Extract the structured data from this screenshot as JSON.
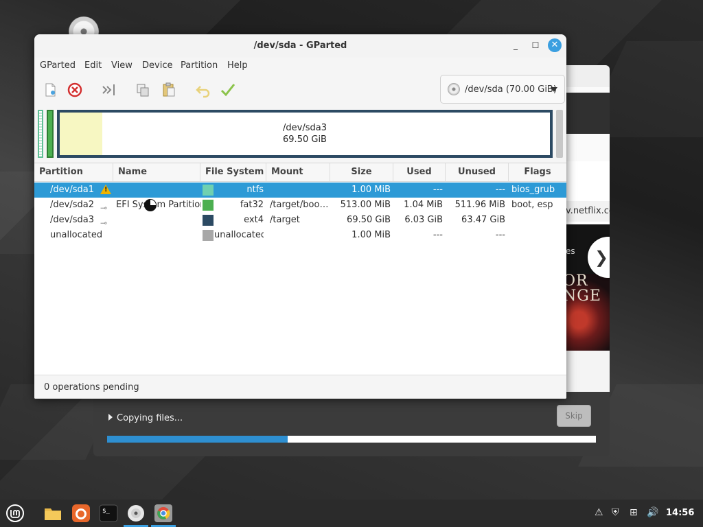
{
  "gparted": {
    "title": "/dev/sda - GParted",
    "menu": [
      "GParted",
      "Edit",
      "View",
      "Device",
      "Partition",
      "Help"
    ],
    "toolbar": [
      {
        "icon": "new-partition-icon"
      },
      {
        "icon": "delete-icon"
      },
      {
        "icon": "resize-move-icon"
      },
      {
        "icon": "copy-icon"
      },
      {
        "icon": "paste-icon"
      },
      {
        "icon": "undo-icon"
      },
      {
        "icon": "apply-icon"
      }
    ],
    "device_selector": "/dev/sda (70.00 GiB)",
    "disk_map": {
      "name": "/dev/sda3",
      "size": "69.50 GiB",
      "used_fraction": 0.087
    },
    "columns": [
      "Partition",
      "Name",
      "File System",
      "Mount Point",
      "Size",
      "Used",
      "Unused",
      "Flags"
    ],
    "rows": [
      {
        "partition": "/dev/sda1",
        "name": "",
        "filesystem": "ntfs",
        "fs_color": "#6fd0b0",
        "mount": "",
        "size": "1.00 MiB",
        "used": "---",
        "unused": "---",
        "flags": "bios_grub",
        "icon": "warning-icon",
        "selected": true
      },
      {
        "partition": "/dev/sda2",
        "name": "EFI System Partition",
        "filesystem": "fat32",
        "fs_color": "#4caf50",
        "mount": "/target/boo…",
        "size": "513.00 MiB",
        "used": "1.04 MiB",
        "unused": "511.96 MiB",
        "flags": "boot, esp",
        "icon": "key-icon",
        "selected": false
      },
      {
        "partition": "/dev/sda3",
        "name": "",
        "filesystem": "ext4",
        "fs_color": "#2c4a63",
        "mount": "/target",
        "size": "69.50 GiB",
        "used": "6.03 GiB",
        "unused": "63.47 GiB",
        "flags": "",
        "icon": "key-icon",
        "selected": false
      },
      {
        "partition": "unallocated",
        "name": "",
        "filesystem": "unallocated",
        "fs_color": "#a8a8a8",
        "mount": "",
        "size": "1.00 MiB",
        "used": "---",
        "unused": "---",
        "flags": "",
        "icon": "",
        "selected": false
      }
    ],
    "status": "0 operations pending"
  },
  "installer": {
    "status": "Copying files...",
    "skip_label": "Skip",
    "progress": 0.37,
    "url_fragment": "v.netflix.co",
    "art_text": "OR\nNGE",
    "es_text": "es"
  },
  "taskbar": {
    "clock": "14:56",
    "apps": [
      "mint-menu-icon",
      "files-icon",
      "firefox-icon",
      "terminal-icon",
      "installer-disc-icon",
      "chromium-icon"
    ]
  }
}
